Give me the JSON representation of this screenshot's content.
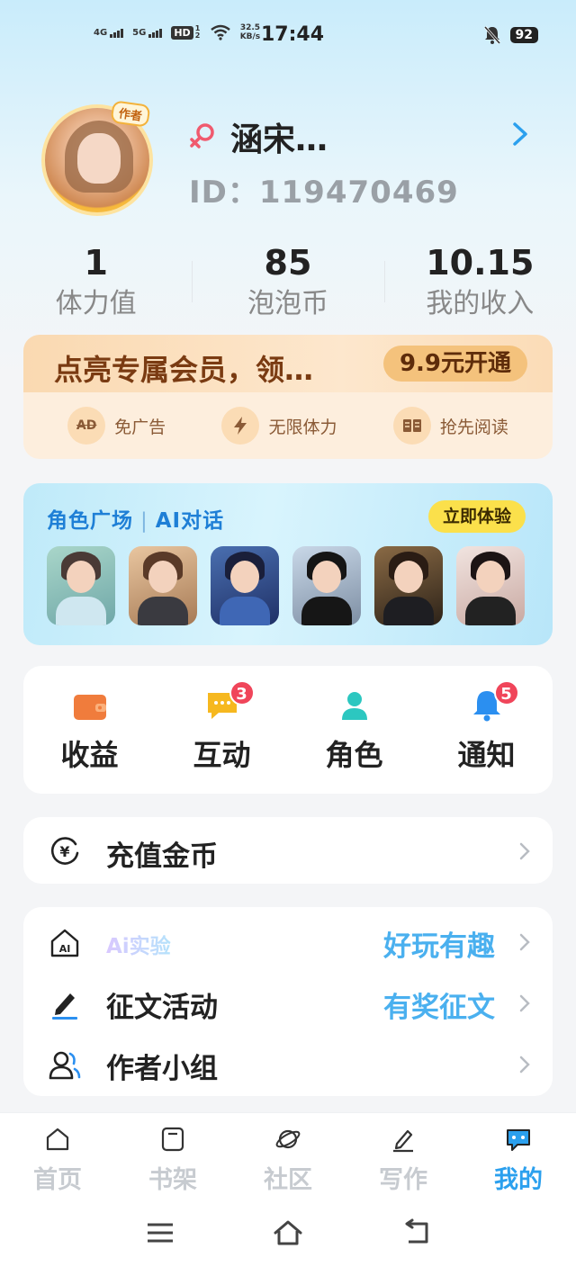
{
  "status_bar": {
    "sig1": "4G",
    "sig2": "5G",
    "hd": "HD",
    "hd_sub": "1 2",
    "speed_value": "32.5",
    "speed_unit": "KB/s",
    "time": "17:44",
    "battery": "92"
  },
  "profile": {
    "author_badge": "作者",
    "username": "涵宋…",
    "user_id": "ID：119470469"
  },
  "stats": [
    {
      "value": "1",
      "label": "体力值"
    },
    {
      "value": "85",
      "label": "泡泡币"
    },
    {
      "value": "10.15",
      "label": "我的收入"
    }
  ],
  "vip": {
    "title": "点亮专属会员，领…",
    "button": "9.9元开通",
    "perks": [
      {
        "icon_text": "AD",
        "icon": "no-ads-icon",
        "label": "免广告"
      },
      {
        "icon_text": "⚡",
        "icon": "lightning-icon",
        "label": "无限体力"
      },
      {
        "icon_text": "▣",
        "icon": "book-icon",
        "label": "抢先阅读"
      }
    ]
  },
  "characters": {
    "title_left": "角色广场",
    "separator": "|",
    "title_right": "AI对话",
    "button": "立即体验"
  },
  "quick_grid": [
    {
      "label": "收益",
      "icon": "wallet-icon",
      "badge": ""
    },
    {
      "label": "互动",
      "icon": "chat-bubble-icon",
      "badge": "3"
    },
    {
      "label": "角色",
      "icon": "person-icon",
      "badge": ""
    },
    {
      "label": "通知",
      "icon": "bell-icon",
      "badge": "5"
    }
  ],
  "recharge": {
    "label": "充值金币",
    "icon": "yuan-coin-icon"
  },
  "menu": [
    {
      "label": "Ai实验",
      "value": "好玩有趣",
      "icon": "ai-house-icon"
    },
    {
      "label": "征文活动",
      "value": "有奖征文",
      "icon": "pen-icon"
    },
    {
      "label": "作者小组",
      "value": "",
      "icon": "group-icon"
    }
  ],
  "tabs": [
    {
      "label": "首页",
      "icon": "home-icon"
    },
    {
      "label": "书架",
      "icon": "bookshelf-icon"
    },
    {
      "label": "社区",
      "icon": "planet-icon"
    },
    {
      "label": "写作",
      "icon": "write-icon"
    },
    {
      "label": "我的",
      "icon": "profile-chat-icon",
      "active": true
    }
  ],
  "colors": {
    "accent": "#2ba0ee",
    "badge": "#f0455a",
    "vip_text": "#7a3b12",
    "try_button": "#fbe04b"
  }
}
